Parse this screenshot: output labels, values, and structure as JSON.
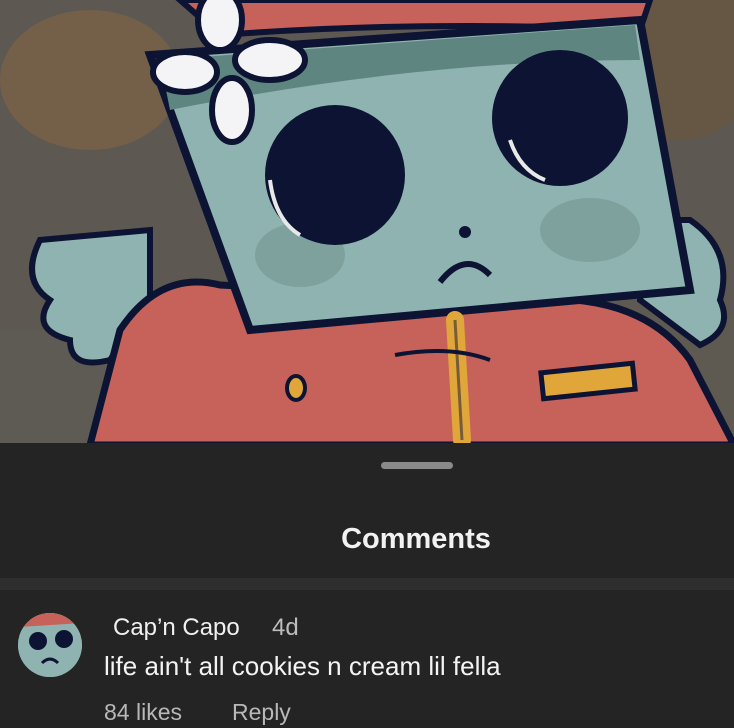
{
  "panel": {
    "title": "Comments"
  },
  "comment": {
    "username": "Cap’n Capo",
    "age": "4d",
    "text": "life ain't all cookies n cream lil fella",
    "likes": "84 likes",
    "reply_label": "Reply"
  },
  "colors": {
    "sheet_bg": "#242424",
    "hat": "#c7625a",
    "skin": "#8fb3b0",
    "outline": "#0d1433",
    "zipper": "#e0a63a"
  }
}
